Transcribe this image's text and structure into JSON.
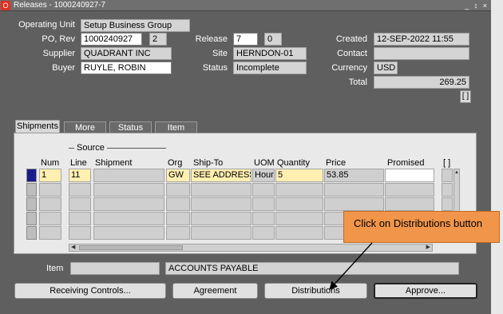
{
  "window": {
    "title": "Releases - 1000240927-7",
    "controls": "_ ↕ ×"
  },
  "header": {
    "operating_unit_label": "Operating Unit",
    "operating_unit": "Setup Business Group",
    "po_rev_label": "PO, Rev",
    "po_number": "1000240927",
    "revision": "2",
    "release_label": "Release",
    "release": "7",
    "release_rev": "0",
    "created_label": "Created",
    "created": "12-SEP-2022 11:55",
    "supplier_label": "Supplier",
    "supplier": "QUADRANT INC",
    "site_label": "Site",
    "site": "HERNDON-01",
    "contact_label": "Contact",
    "contact": "",
    "buyer_label": "Buyer",
    "buyer": "RUYLE, ROBIN",
    "status_label": "Status",
    "status": "Incomplete",
    "currency_label": "Currency",
    "currency": "USD",
    "total_label": "Total",
    "total": "269.25",
    "dff": "[ ]"
  },
  "tabs": [
    {
      "label": "Shipments",
      "active": true
    },
    {
      "label": "More",
      "active": false
    },
    {
      "label": "Status",
      "active": false
    },
    {
      "label": "Item",
      "active": false
    }
  ],
  "grid": {
    "group_header": "Source",
    "columns": [
      "Num",
      "Line",
      "Shipment",
      "Org",
      "Ship-To",
      "UOM",
      "Quantity",
      "Price",
      "Promised",
      "[ ]"
    ],
    "rows": [
      {
        "num": "1",
        "line": "11",
        "shipment": "",
        "org": "GW",
        "ship_to": "SEE ADDRESS",
        "uom": "Hour",
        "quantity": "5",
        "price": "53.85",
        "promised": ""
      }
    ]
  },
  "footer": {
    "item_label": "Item",
    "item_value": "",
    "item_description": "ACCOUNTS PAYABLE"
  },
  "buttons": {
    "receiving_controls": "Receiving Controls...",
    "agreement": "Agreement",
    "distributions": "Distributions",
    "approve": "Approve..."
  },
  "callout": {
    "text": "Click on Distributions button"
  },
  "colors": {
    "window_bg": "#5f5f5f",
    "required_field": "#ffefb0",
    "callout": "#f0954a"
  }
}
